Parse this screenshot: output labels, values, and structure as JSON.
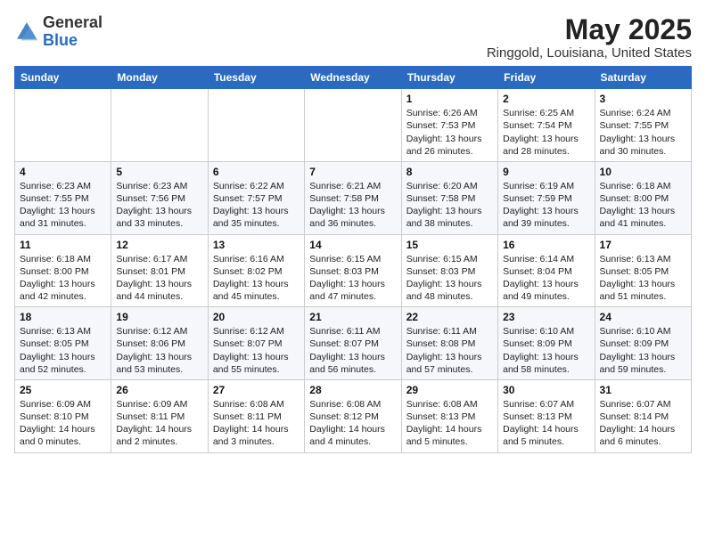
{
  "header": {
    "logo_general": "General",
    "logo_blue": "Blue",
    "month_year": "May 2025",
    "location": "Ringgold, Louisiana, United States"
  },
  "weekdays": [
    "Sunday",
    "Monday",
    "Tuesday",
    "Wednesday",
    "Thursday",
    "Friday",
    "Saturday"
  ],
  "weeks": [
    [
      {
        "day": "",
        "info": ""
      },
      {
        "day": "",
        "info": ""
      },
      {
        "day": "",
        "info": ""
      },
      {
        "day": "",
        "info": ""
      },
      {
        "day": "1",
        "sunrise": "Sunrise: 6:26 AM",
        "sunset": "Sunset: 7:53 PM",
        "daylight": "Daylight: 13 hours and 26 minutes."
      },
      {
        "day": "2",
        "sunrise": "Sunrise: 6:25 AM",
        "sunset": "Sunset: 7:54 PM",
        "daylight": "Daylight: 13 hours and 28 minutes."
      },
      {
        "day": "3",
        "sunrise": "Sunrise: 6:24 AM",
        "sunset": "Sunset: 7:55 PM",
        "daylight": "Daylight: 13 hours and 30 minutes."
      }
    ],
    [
      {
        "day": "4",
        "sunrise": "Sunrise: 6:23 AM",
        "sunset": "Sunset: 7:55 PM",
        "daylight": "Daylight: 13 hours and 31 minutes."
      },
      {
        "day": "5",
        "sunrise": "Sunrise: 6:23 AM",
        "sunset": "Sunset: 7:56 PM",
        "daylight": "Daylight: 13 hours and 33 minutes."
      },
      {
        "day": "6",
        "sunrise": "Sunrise: 6:22 AM",
        "sunset": "Sunset: 7:57 PM",
        "daylight": "Daylight: 13 hours and 35 minutes."
      },
      {
        "day": "7",
        "sunrise": "Sunrise: 6:21 AM",
        "sunset": "Sunset: 7:58 PM",
        "daylight": "Daylight: 13 hours and 36 minutes."
      },
      {
        "day": "8",
        "sunrise": "Sunrise: 6:20 AM",
        "sunset": "Sunset: 7:58 PM",
        "daylight": "Daylight: 13 hours and 38 minutes."
      },
      {
        "day": "9",
        "sunrise": "Sunrise: 6:19 AM",
        "sunset": "Sunset: 7:59 PM",
        "daylight": "Daylight: 13 hours and 39 minutes."
      },
      {
        "day": "10",
        "sunrise": "Sunrise: 6:18 AM",
        "sunset": "Sunset: 8:00 PM",
        "daylight": "Daylight: 13 hours and 41 minutes."
      }
    ],
    [
      {
        "day": "11",
        "sunrise": "Sunrise: 6:18 AM",
        "sunset": "Sunset: 8:00 PM",
        "daylight": "Daylight: 13 hours and 42 minutes."
      },
      {
        "day": "12",
        "sunrise": "Sunrise: 6:17 AM",
        "sunset": "Sunset: 8:01 PM",
        "daylight": "Daylight: 13 hours and 44 minutes."
      },
      {
        "day": "13",
        "sunrise": "Sunrise: 6:16 AM",
        "sunset": "Sunset: 8:02 PM",
        "daylight": "Daylight: 13 hours and 45 minutes."
      },
      {
        "day": "14",
        "sunrise": "Sunrise: 6:15 AM",
        "sunset": "Sunset: 8:03 PM",
        "daylight": "Daylight: 13 hours and 47 minutes."
      },
      {
        "day": "15",
        "sunrise": "Sunrise: 6:15 AM",
        "sunset": "Sunset: 8:03 PM",
        "daylight": "Daylight: 13 hours and 48 minutes."
      },
      {
        "day": "16",
        "sunrise": "Sunrise: 6:14 AM",
        "sunset": "Sunset: 8:04 PM",
        "daylight": "Daylight: 13 hours and 49 minutes."
      },
      {
        "day": "17",
        "sunrise": "Sunrise: 6:13 AM",
        "sunset": "Sunset: 8:05 PM",
        "daylight": "Daylight: 13 hours and 51 minutes."
      }
    ],
    [
      {
        "day": "18",
        "sunrise": "Sunrise: 6:13 AM",
        "sunset": "Sunset: 8:05 PM",
        "daylight": "Daylight: 13 hours and 52 minutes."
      },
      {
        "day": "19",
        "sunrise": "Sunrise: 6:12 AM",
        "sunset": "Sunset: 8:06 PM",
        "daylight": "Daylight: 13 hours and 53 minutes."
      },
      {
        "day": "20",
        "sunrise": "Sunrise: 6:12 AM",
        "sunset": "Sunset: 8:07 PM",
        "daylight": "Daylight: 13 hours and 55 minutes."
      },
      {
        "day": "21",
        "sunrise": "Sunrise: 6:11 AM",
        "sunset": "Sunset: 8:07 PM",
        "daylight": "Daylight: 13 hours and 56 minutes."
      },
      {
        "day": "22",
        "sunrise": "Sunrise: 6:11 AM",
        "sunset": "Sunset: 8:08 PM",
        "daylight": "Daylight: 13 hours and 57 minutes."
      },
      {
        "day": "23",
        "sunrise": "Sunrise: 6:10 AM",
        "sunset": "Sunset: 8:09 PM",
        "daylight": "Daylight: 13 hours and 58 minutes."
      },
      {
        "day": "24",
        "sunrise": "Sunrise: 6:10 AM",
        "sunset": "Sunset: 8:09 PM",
        "daylight": "Daylight: 13 hours and 59 minutes."
      }
    ],
    [
      {
        "day": "25",
        "sunrise": "Sunrise: 6:09 AM",
        "sunset": "Sunset: 8:10 PM",
        "daylight": "Daylight: 14 hours and 0 minutes."
      },
      {
        "day": "26",
        "sunrise": "Sunrise: 6:09 AM",
        "sunset": "Sunset: 8:11 PM",
        "daylight": "Daylight: 14 hours and 2 minutes."
      },
      {
        "day": "27",
        "sunrise": "Sunrise: 6:08 AM",
        "sunset": "Sunset: 8:11 PM",
        "daylight": "Daylight: 14 hours and 3 minutes."
      },
      {
        "day": "28",
        "sunrise": "Sunrise: 6:08 AM",
        "sunset": "Sunset: 8:12 PM",
        "daylight": "Daylight: 14 hours and 4 minutes."
      },
      {
        "day": "29",
        "sunrise": "Sunrise: 6:08 AM",
        "sunset": "Sunset: 8:13 PM",
        "daylight": "Daylight: 14 hours and 5 minutes."
      },
      {
        "day": "30",
        "sunrise": "Sunrise: 6:07 AM",
        "sunset": "Sunset: 8:13 PM",
        "daylight": "Daylight: 14 hours and 5 minutes."
      },
      {
        "day": "31",
        "sunrise": "Sunrise: 6:07 AM",
        "sunset": "Sunset: 8:14 PM",
        "daylight": "Daylight: 14 hours and 6 minutes."
      }
    ]
  ]
}
